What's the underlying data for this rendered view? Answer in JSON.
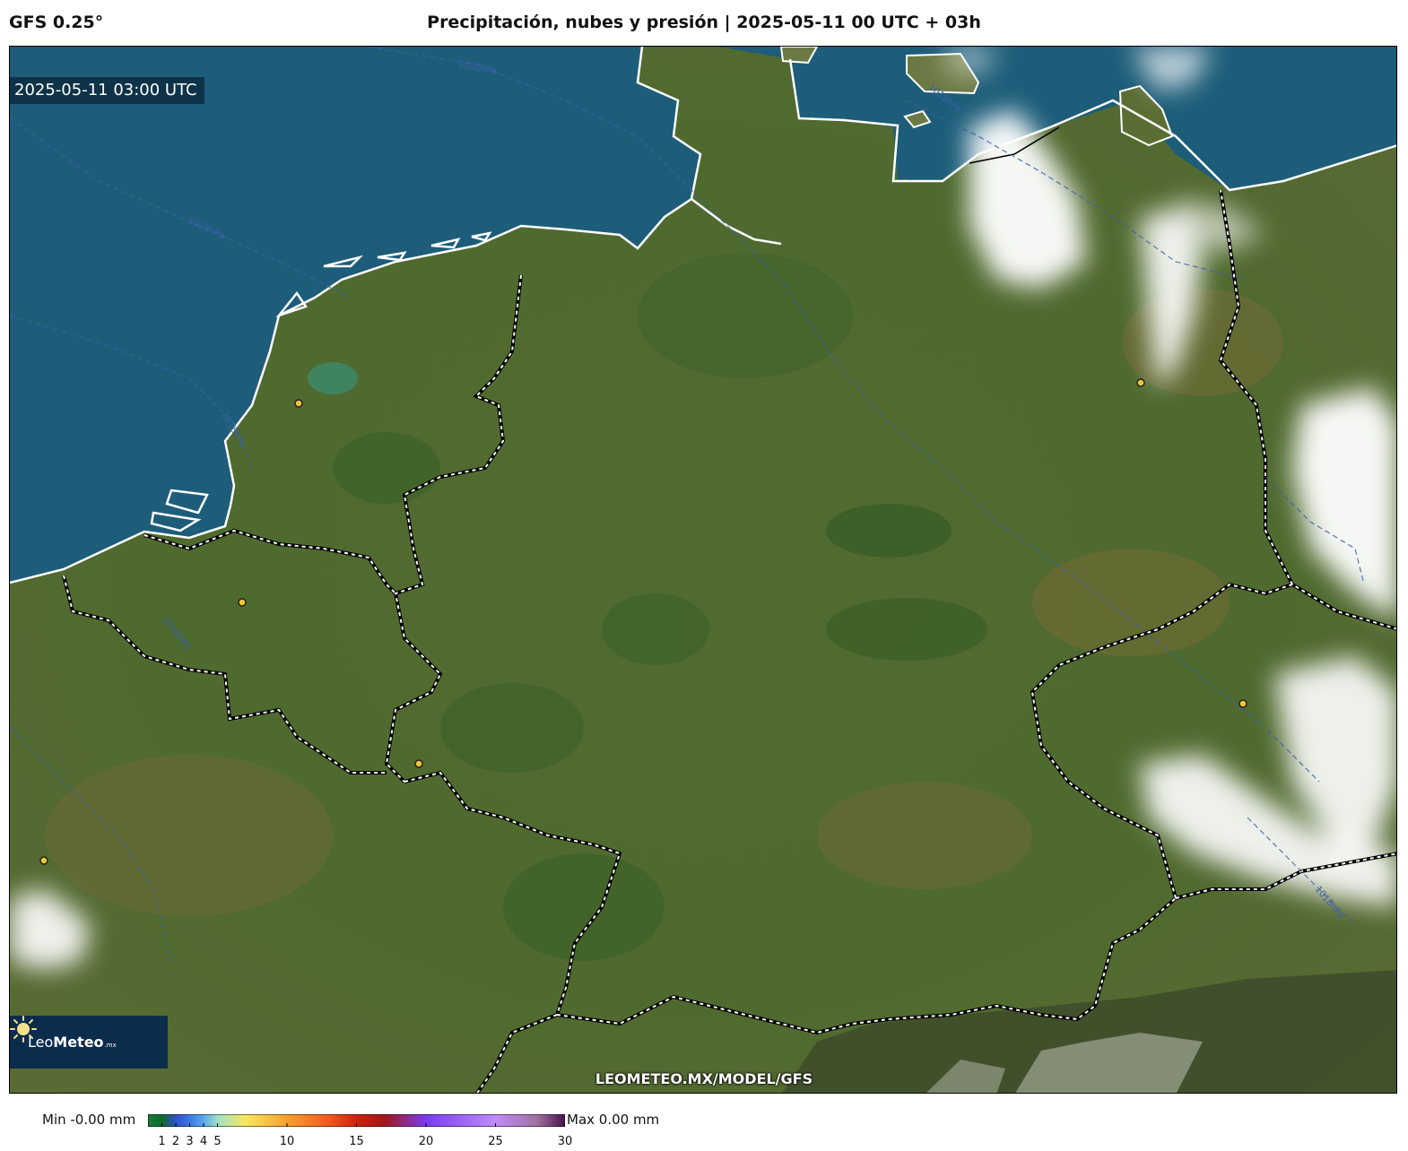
{
  "header": {
    "model": "GFS 0.25°",
    "title": "Precipitación, nubes y presión | 2025-05-11 00 UTC + 03h"
  },
  "map": {
    "valid_time": "2025-05-11 03:00 UTC",
    "isobar_labels": [
      "1020hPa",
      "1018hPa",
      "1018hPa",
      "1018hPa",
      "1018hPa",
      "1018hPa"
    ],
    "colors": {
      "sea": "#1d5d79",
      "land": "#4d6a2e",
      "cloud": "#ffffff",
      "isobar": "#3c5fa8",
      "coast": "#ffffff",
      "border": "#000000",
      "city_dot": "#f2c63a"
    }
  },
  "logo": {
    "brand_regular": "Leo",
    "brand_bold": "Meteo",
    "brand_tld": ".mx",
    "icon": "sun-icon"
  },
  "footer": {
    "url": "LEOMETEO.MX/MODEL/GFS"
  },
  "legend": {
    "min_label": "Min -0.00 mm",
    "max_label": "Max 0.00 mm",
    "range": [
      0,
      30
    ],
    "ticks": [
      {
        "value": 1,
        "label": "1"
      },
      {
        "value": 2,
        "label": "2"
      },
      {
        "value": 3,
        "label": "3"
      },
      {
        "value": 4,
        "label": "4"
      },
      {
        "value": 5,
        "label": "5"
      },
      {
        "value": 10,
        "label": "10"
      },
      {
        "value": 15,
        "label": "15"
      },
      {
        "value": 20,
        "label": "20"
      },
      {
        "value": 25,
        "label": "25"
      },
      {
        "value": 30,
        "label": "30"
      }
    ],
    "stops": [
      {
        "value": 0,
        "color": "#1a7a3a"
      },
      {
        "value": 1,
        "color": "#0f6b28"
      },
      {
        "value": 2,
        "color": "#3050c8"
      },
      {
        "value": 3,
        "color": "#3c78e0"
      },
      {
        "value": 4,
        "color": "#5aa8ee"
      },
      {
        "value": 5,
        "color": "#9fe0c8"
      },
      {
        "value": 7,
        "color": "#f8e860"
      },
      {
        "value": 10,
        "color": "#f5a030"
      },
      {
        "value": 13,
        "color": "#f25a20"
      },
      {
        "value": 15,
        "color": "#d02010"
      },
      {
        "value": 17,
        "color": "#a01818"
      },
      {
        "value": 20,
        "color": "#7a3cf0"
      },
      {
        "value": 25,
        "color": "#c08cf8"
      },
      {
        "value": 28,
        "color": "#a070a0"
      },
      {
        "value": 30,
        "color": "#4a1050"
      }
    ]
  }
}
